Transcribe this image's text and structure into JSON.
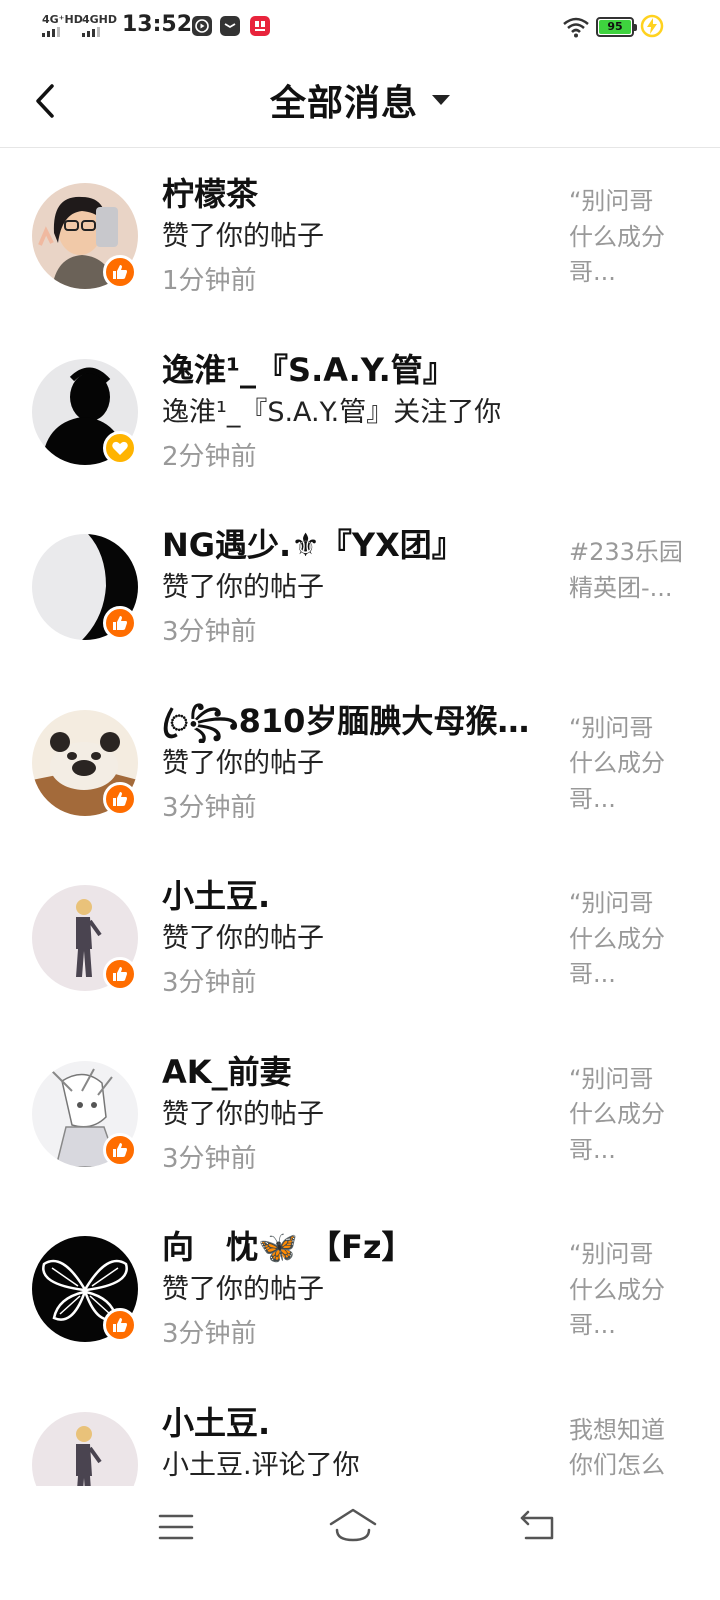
{
  "status_bar": {
    "network_1": "4G⁺HD",
    "network_2": "4GHD",
    "time": "13:52",
    "battery": "95",
    "colors": {
      "battery_fill": "#3ed33e",
      "charge": "#ffd21f"
    }
  },
  "header": {
    "title": "全部消息",
    "back_icon": "chevron-left-icon",
    "dropdown_icon": "caret-down-icon"
  },
  "accent_color": "#ff6d00",
  "messages": [
    {
      "name": "柠檬茶",
      "action": "赞了你的帖子",
      "time": "1分钟前",
      "preview": [
        "“别问哥",
        "什么成分",
        "哥..."
      ],
      "badge": "thumb-up-icon"
    },
    {
      "name": "逸淮¹_『S.A.Y.管』",
      "action": "逸淮¹_『S.A.Y.管』关注了你",
      "time": "2分钟前",
      "preview": [],
      "badge": "heart-icon"
    },
    {
      "name": "NG遇少.⚜『YX团』",
      "action": "赞了你的帖子",
      "time": "3分钟前",
      "preview": [
        "#233乐园",
        "精英团-..."
      ],
      "badge": "thumb-up-icon"
    },
    {
      "name": "ꦿ꧂810岁腼腆大母猴™...",
      "action": "赞了你的帖子",
      "time": "3分钟前",
      "preview": [
        "“别问哥",
        "什么成分",
        "哥..."
      ],
      "badge": "thumb-up-icon"
    },
    {
      "name": "小土豆.",
      "action": "赞了你的帖子",
      "time": "3分钟前",
      "preview": [
        "“别问哥",
        "什么成分",
        "哥..."
      ],
      "badge": "thumb-up-icon"
    },
    {
      "name": "AK_前妻",
      "action": "赞了你的帖子",
      "time": "3分钟前",
      "preview": [
        "“别问哥",
        "什么成分",
        "哥..."
      ],
      "badge": "thumb-up-icon"
    },
    {
      "name": "向　忱🦋 【Fz】",
      "action": "赞了你的帖子",
      "time": "3分钟前",
      "preview": [
        "“别问哥",
        "什么成分",
        "哥..."
      ],
      "badge": "thumb-up-icon"
    },
    {
      "name": "小土豆.",
      "action": "小土豆.评论了你",
      "time": "",
      "preview": [
        "我想知道",
        "你们怎么"
      ],
      "badge": "comment-icon"
    }
  ],
  "nav_bar": {
    "menu_icon": "menu-icon",
    "home_icon": "home-icon",
    "back_icon": "back-icon"
  }
}
